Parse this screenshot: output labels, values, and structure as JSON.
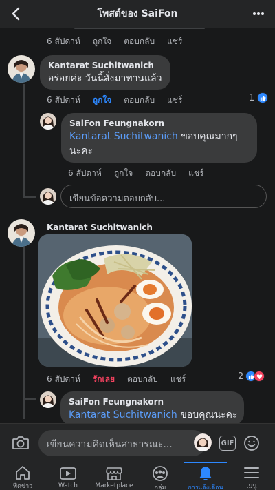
{
  "header": {
    "title": "โพสต์ของ SaiFon"
  },
  "top_actions": {
    "time": "6 สัปดาห์",
    "like": "ถูกใจ",
    "reply": "ตอบกลับ",
    "share": "แชร์"
  },
  "comment1": {
    "author": "Kantarat Suchitwanich",
    "text": "อร่อยค่ะ วันนี้สั่งมาทานแล้ว",
    "time": "6 สัปดาห์",
    "like": "ถูกใจ",
    "reply": "ตอบกลับ",
    "share": "แชร์",
    "reaction_count": "1"
  },
  "reply1": {
    "author": "SaiFon Feungnakorn",
    "mention": "Kantarat Suchitwanich",
    "text": " ขอบคุณมากๆนะคะ",
    "time": "6 สัปดาห์",
    "like": "ถูกใจ",
    "reply": "ตอบกลับ",
    "share": "แชร์"
  },
  "reply_input": {
    "placeholder": "เขียนข้อความตอบกลับ..."
  },
  "comment2": {
    "author": "Kantarat Suchitwanich",
    "time": "6 สัปดาห์",
    "like": "รักเลย",
    "reply": "ตอบกลับ",
    "share": "แชร์",
    "reaction_count": "2"
  },
  "reply2": {
    "author": "SaiFon Feungnakorn",
    "mention": "Kantarat Suchitwanich",
    "text": " ขอบคุณนะคะ"
  },
  "composer": {
    "placeholder": "เขียนความคิดเห็นสาธารณะ...",
    "gif": "GIF"
  },
  "tabs": [
    {
      "label": "ฟีดข่าว",
      "icon": "home-icon"
    },
    {
      "label": "Watch",
      "icon": "watch-icon"
    },
    {
      "label": "Marketplace",
      "icon": "marketplace-icon"
    },
    {
      "label": "กลุ่ม",
      "icon": "groups-icon"
    },
    {
      "label": "การแจ้งเตือน",
      "icon": "bell-icon"
    },
    {
      "label": "เมนู",
      "icon": "menu-icon"
    }
  ],
  "colors": {
    "accent": "#2d88ff",
    "love": "#f3425f",
    "mention": "#5b9cf8"
  }
}
